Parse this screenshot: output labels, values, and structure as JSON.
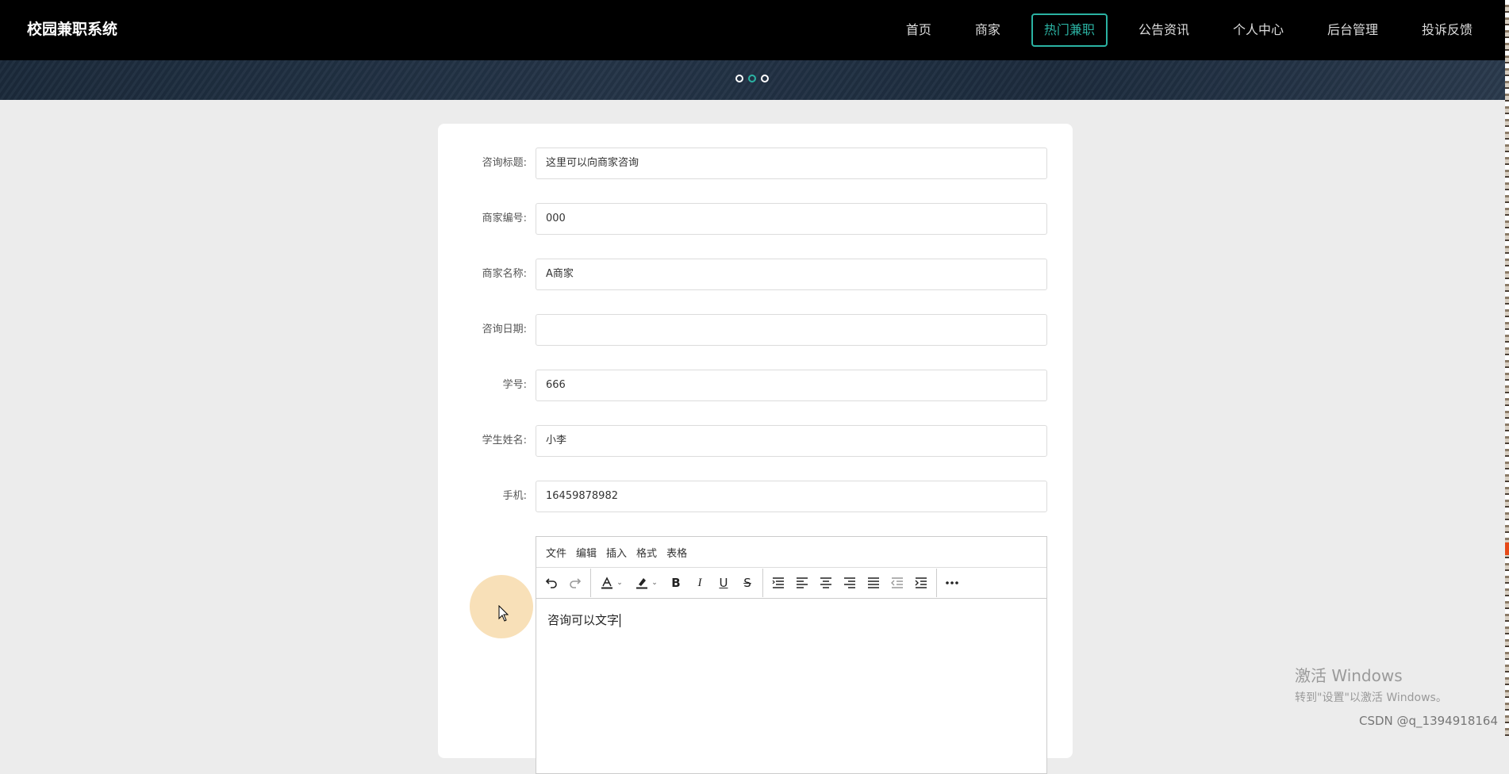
{
  "app": {
    "brand": "校园兼职系统"
  },
  "nav": {
    "items": [
      {
        "label": "首页"
      },
      {
        "label": "商家"
      },
      {
        "label": "热门兼职",
        "active": true
      },
      {
        "label": "公告资讯"
      },
      {
        "label": "个人中心"
      },
      {
        "label": "后台管理"
      },
      {
        "label": "投诉反馈"
      }
    ],
    "accent_color": "#2bb3a3"
  },
  "carousel": {
    "dot_count": 3,
    "active_index": 1
  },
  "form": {
    "fields": [
      {
        "label": "咨询标题:",
        "value": "这里可以向商家咨询"
      },
      {
        "label": "商家编号:",
        "value": "000"
      },
      {
        "label": "商家名称:",
        "value": "A商家"
      },
      {
        "label": "咨询日期:",
        "value": ""
      },
      {
        "label": "学号:",
        "value": "666"
      },
      {
        "label": "学生姓名:",
        "value": "小李"
      },
      {
        "label": "手机:",
        "value": "16459878982"
      }
    ]
  },
  "editor": {
    "menus": [
      "文件",
      "编辑",
      "插入",
      "格式",
      "表格"
    ],
    "toolbar_icons": [
      "undo-icon",
      "redo-icon",
      "text-color-icon",
      "highlight-color-icon",
      "bold-icon",
      "italic-icon",
      "underline-icon",
      "strikethrough-icon",
      "line-height-icon",
      "align-left-icon",
      "align-center-icon",
      "align-right-icon",
      "justify-icon",
      "outdent-icon",
      "indent-icon",
      "more-icon"
    ],
    "content": "咨询可以文字"
  },
  "watermark": {
    "windows_title": "激活 Windows",
    "windows_sub": "转到\"设置\"以激活 Windows。",
    "csdn": "CSDN @q_1394918164"
  }
}
